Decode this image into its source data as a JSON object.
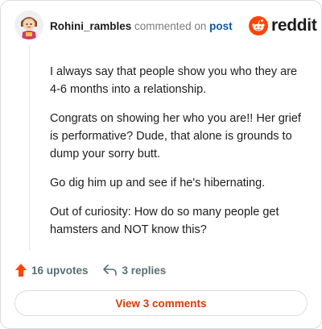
{
  "comment": {
    "username": "Rohini_rambles",
    "commented_text": "commented on",
    "post_link": "post",
    "paragraphs": [
      "I always say that people show you who they are 4-6 months into a relationship.",
      "Congrats on showing her who you are!! Her grief is performative? Dude, that alone is grounds to dump your sorry butt.",
      "Go dig him up and see if he's hibernating.",
      "Out of curiosity: How do so many people get hamsters and NOT know this?"
    ]
  },
  "brand": {
    "wordmark": "reddit",
    "color": "#ff4500"
  },
  "actions": {
    "upvotes": "16 upvotes",
    "replies": "3 replies"
  },
  "footer": {
    "view_comments": "View 3 comments"
  },
  "colors": {
    "upvote": "#ff4500",
    "link": "#0b57a4",
    "view_button_text": "#d93a00"
  }
}
